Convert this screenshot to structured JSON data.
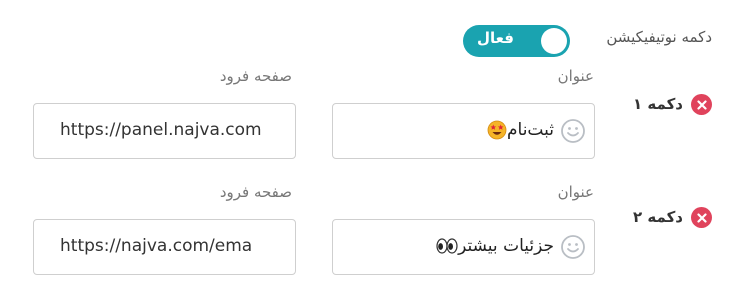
{
  "notification_toggle": {
    "label": "دکمه نوتیفیکیشن",
    "state_text": "فعال",
    "enabled": true,
    "color": "#1aa3b0"
  },
  "buttons": [
    {
      "row_label": "دکمه ۱",
      "title_label": "عنوان",
      "title_value": "ثبت‌نام",
      "title_emoji": "star-struck-emoji",
      "url_label": "صفحه فرود",
      "url_value": "https://panel.najva.com"
    },
    {
      "row_label": "دکمه ۲",
      "title_label": "عنوان",
      "title_value": "جزئیات بیشتر",
      "title_emoji": "eyes-emoji",
      "url_label": "صفحه فرود",
      "url_value": "https://najva.com/ema"
    }
  ],
  "icons": {
    "remove": "close-circle-icon",
    "emoji_picker": "smiley-icon"
  },
  "colors": {
    "accent": "#1aa3b0",
    "remove": "#e0435c"
  }
}
